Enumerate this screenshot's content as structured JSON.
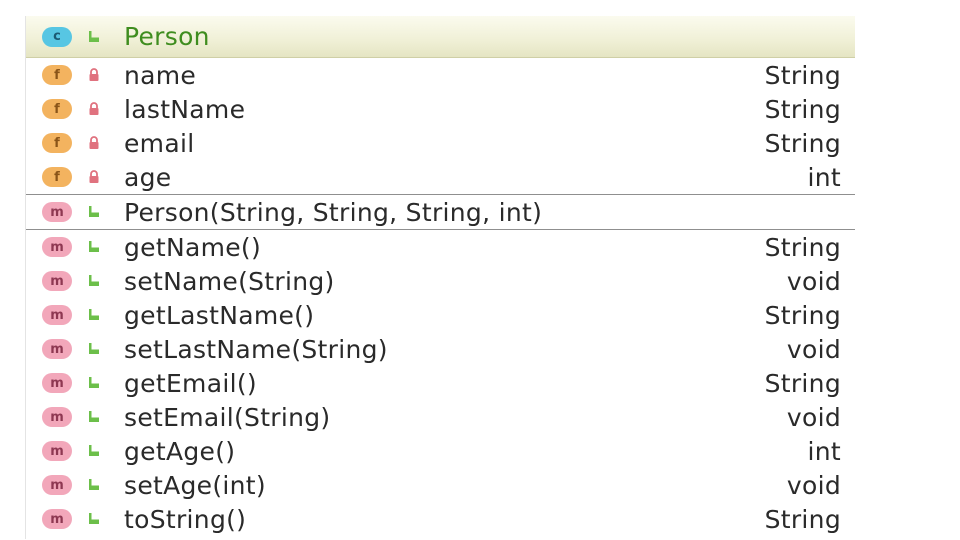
{
  "class": {
    "kind_badge": "c",
    "visibility_icon": "public-icon",
    "name": "Person"
  },
  "fields": [
    {
      "badge": "f",
      "visibility_icon": "private-lock-icon",
      "name": "name",
      "type": "String"
    },
    {
      "badge": "f",
      "visibility_icon": "private-lock-icon",
      "name": "lastName",
      "type": "String"
    },
    {
      "badge": "f",
      "visibility_icon": "private-lock-icon",
      "name": "email",
      "type": "String"
    },
    {
      "badge": "f",
      "visibility_icon": "private-lock-icon",
      "name": "age",
      "type": "int"
    }
  ],
  "constructors": [
    {
      "badge": "m",
      "visibility_icon": "public-icon",
      "name": "Person(String, String, String, int)",
      "type": ""
    }
  ],
  "methods": [
    {
      "badge": "m",
      "visibility_icon": "public-icon",
      "name": "getName()",
      "type": "String"
    },
    {
      "badge": "m",
      "visibility_icon": "public-icon",
      "name": "setName(String)",
      "type": "void"
    },
    {
      "badge": "m",
      "visibility_icon": "public-icon",
      "name": "getLastName()",
      "type": "String"
    },
    {
      "badge": "m",
      "visibility_icon": "public-icon",
      "name": "setLastName(String)",
      "type": "void"
    },
    {
      "badge": "m",
      "visibility_icon": "public-icon",
      "name": "getEmail()",
      "type": "String"
    },
    {
      "badge": "m",
      "visibility_icon": "public-icon",
      "name": "setEmail(String)",
      "type": "void"
    },
    {
      "badge": "m",
      "visibility_icon": "public-icon",
      "name": "getAge()",
      "type": "int"
    },
    {
      "badge": "m",
      "visibility_icon": "public-icon",
      "name": "setAge(int)",
      "type": "void"
    },
    {
      "badge": "m",
      "visibility_icon": "public-icon",
      "name": "toString()",
      "type": "String"
    }
  ],
  "colors": {
    "class_badge": "#57c6e3",
    "field_badge": "#f3b35f",
    "method_badge": "#f2a7ba",
    "class_name": "#3f8d1f",
    "public_icon": "#6cbf4a",
    "private_icon": "#e0727f"
  }
}
